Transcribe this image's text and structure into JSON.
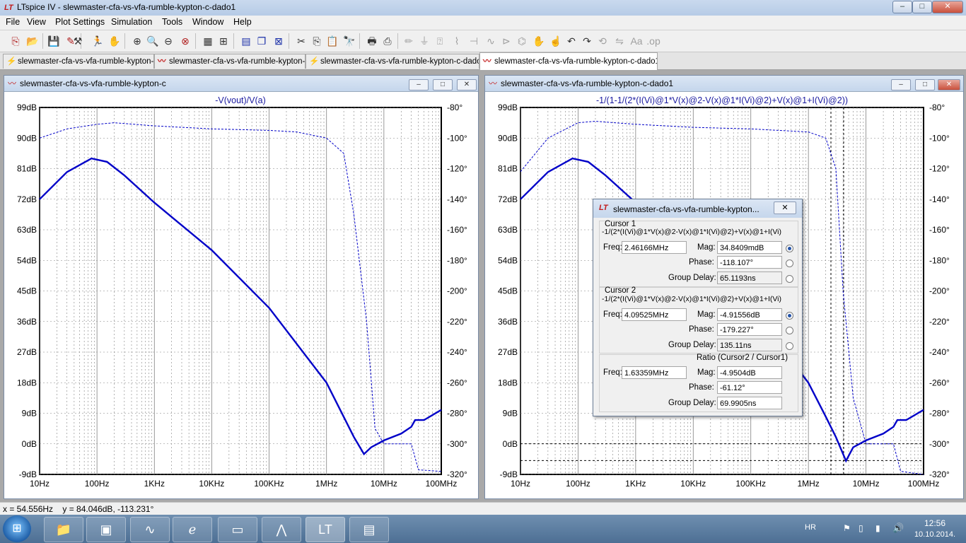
{
  "window": {
    "title": "LTspice IV - slewmaster-cfa-vs-vfa-rumble-kypton-c-dado1",
    "min_glyph": "–",
    "max_glyph": "□",
    "close_glyph": "✕"
  },
  "menu": [
    "File",
    "View",
    "Plot Settings",
    "Simulation",
    "Tools",
    "Window",
    "Help"
  ],
  "tabs": [
    {
      "label": "slewmaster-cfa-vs-vfa-rumble-kypton-c",
      "icon": "schematic-icon"
    },
    {
      "label": "slewmaster-cfa-vs-vfa-rumble-kypton-c",
      "icon": "waveform-icon"
    },
    {
      "label": "slewmaster-cfa-vs-vfa-rumble-kypton-c-dado1",
      "icon": "schematic-icon"
    },
    {
      "label": "slewmaster-cfa-vs-vfa-rumble-kypton-c-dado1",
      "icon": "waveform-icon"
    }
  ],
  "plots": {
    "left": {
      "window_title": "slewmaster-cfa-vs-vfa-rumble-kypton-c",
      "trace_label": "-V(vout)/V(a)"
    },
    "right": {
      "window_title": "slewmaster-cfa-vs-vfa-rumble-kypton-c-dado1",
      "trace_label": "-1/(1-1/(2*(I(Vi)@1*V(x)@2-V(x)@1*I(Vi)@2)+V(x)@1+I(Vi)@2))"
    },
    "y_left_ticks": [
      "99dB",
      "90dB",
      "81dB",
      "72dB",
      "63dB",
      "54dB",
      "45dB",
      "36dB",
      "27dB",
      "18dB",
      "9dB",
      "0dB",
      "-9dB"
    ],
    "y_right_ticks": [
      "-80°",
      "-100°",
      "-120°",
      "-140°",
      "-160°",
      "-180°",
      "-200°",
      "-220°",
      "-240°",
      "-260°",
      "-280°",
      "-300°",
      "-320°"
    ],
    "x_ticks": [
      "10Hz",
      "100Hz",
      "1KHz",
      "10KHz",
      "100KHz",
      "1MHz",
      "10MHz",
      "100MHz"
    ]
  },
  "chart_data": [
    {
      "type": "line",
      "title": "-V(vout)/V(a)",
      "xlabel": "",
      "ylabel": "",
      "x_scale": "log",
      "xlim": [
        10,
        100000000
      ],
      "ylim": [
        -9,
        99
      ],
      "y2lim": [
        -320,
        -80
      ],
      "grid": true,
      "series": [
        {
          "axis": "magnitude_dB",
          "style": "solid",
          "color": "#0000c8",
          "x": [
            10,
            30,
            80,
            150,
            300,
            1000,
            10000,
            100000,
            1000000,
            3000000,
            4500000,
            6000000,
            10000000,
            20000000,
            30000000,
            35000000,
            50000000,
            100000000
          ],
          "y": [
            72,
            80,
            84,
            83,
            79,
            71,
            57,
            40,
            18,
            2,
            -3,
            -1,
            1,
            3,
            5,
            7,
            7,
            10
          ]
        },
        {
          "axis": "phase_deg",
          "style": "dashed",
          "color": "#0000c8",
          "x": [
            10,
            30,
            100,
            200,
            1000,
            10000,
            100000,
            300000,
            1000000,
            2000000,
            3000000,
            5000000,
            7000000,
            10000000,
            20000000,
            30000000,
            40000000,
            100000000
          ],
          "y": [
            -100,
            -94,
            -91,
            -90,
            -92,
            -94,
            -95,
            -96,
            -100,
            -110,
            -150,
            -220,
            -290,
            -300,
            -300,
            -300,
            -317,
            -318
          ]
        }
      ]
    },
    {
      "type": "line",
      "title": "-1/(1-1/(2*(I(Vi)@1*V(x)@2-V(x)@1*I(Vi)@2)+V(x)@1+I(Vi)@2))",
      "xlabel": "",
      "ylabel": "",
      "x_scale": "log",
      "xlim": [
        10,
        100000000
      ],
      "ylim": [
        -9,
        99
      ],
      "y2lim": [
        -320,
        -80
      ],
      "grid": true,
      "series": [
        {
          "axis": "magnitude_dB",
          "style": "solid",
          "color": "#0000c8",
          "x": [
            10,
            30,
            80,
            150,
            300,
            1000,
            10000,
            100000,
            1000000,
            2000000,
            3000000,
            4500000,
            6000000,
            10000000,
            20000000,
            30000000,
            35000000,
            50000000,
            100000000
          ],
          "y": [
            72,
            80,
            84,
            83,
            79,
            71,
            57,
            40,
            18,
            8,
            2,
            -5,
            -1,
            1,
            3,
            5,
            7,
            7,
            10
          ]
        },
        {
          "axis": "phase_deg",
          "style": "dashed",
          "color": "#0000c8",
          "x": [
            10,
            30,
            100,
            200,
            1000,
            10000,
            100000,
            300000,
            1000000,
            2000000,
            3000000,
            4000000,
            6000000,
            10000000,
            20000000,
            30000000,
            40000000,
            100000000
          ],
          "y": [
            -122,
            -100,
            -90,
            -89,
            -91,
            -93,
            -94,
            -95,
            -96,
            -100,
            -120,
            -200,
            -270,
            -300,
            -300,
            -300,
            -318,
            -320
          ]
        }
      ],
      "cursors": [
        {
          "freq_hz": 2461660,
          "mag_db": 0.0348409
        },
        {
          "freq_hz": 4095250,
          "mag_db": -4.91556
        }
      ]
    }
  ],
  "dialog": {
    "title": "slewmaster-cfa-vs-vfa-rumble-kypton...",
    "cursor1": {
      "header": "Cursor 1",
      "expr": "-1/(2*(I(Vi)@1*V(x)@2-V(x)@1*I(Vi)@2)+V(x)@1+I(Vi)",
      "freq_label": "Freq:",
      "freq": "2.46166MHz",
      "mag_label": "Mag:",
      "mag": "34.8409mdB",
      "phase_label": "Phase:",
      "phase": "-118.107°",
      "gd_label": "Group Delay:",
      "gd": "65.1193ns"
    },
    "cursor2": {
      "header": "Cursor 2",
      "expr": "-1/(2*(I(Vi)@1*V(x)@2-V(x)@1*I(Vi)@2)+V(x)@1+I(Vi)",
      "freq_label": "Freq:",
      "freq": "4.09525MHz",
      "mag_label": "Mag:",
      "mag": "-4.91556dB",
      "phase_label": "Phase:",
      "phase": "-179.227°",
      "gd_label": "Group Delay:",
      "gd": "135.11ns"
    },
    "ratio": {
      "header": "Ratio (Cursor2 / Cursor1)",
      "freq_label": "Freq:",
      "freq": "1.63359MHz",
      "mag_label": "Mag:",
      "mag": "-4.9504dB",
      "phase_label": "Phase:",
      "phase": "-61.12°",
      "gd_label": "Group Delay:",
      "gd": "69.9905ns"
    }
  },
  "status": {
    "readout": "x = 54.556Hz    y = 84.046dB, -113.231°"
  },
  "taskbar": {
    "lang": "HR",
    "time": "12:56",
    "date": "10.10.2014."
  },
  "colors": {
    "trace": "#0000c8",
    "grid": "#808080",
    "label": "#1a1aa0"
  }
}
